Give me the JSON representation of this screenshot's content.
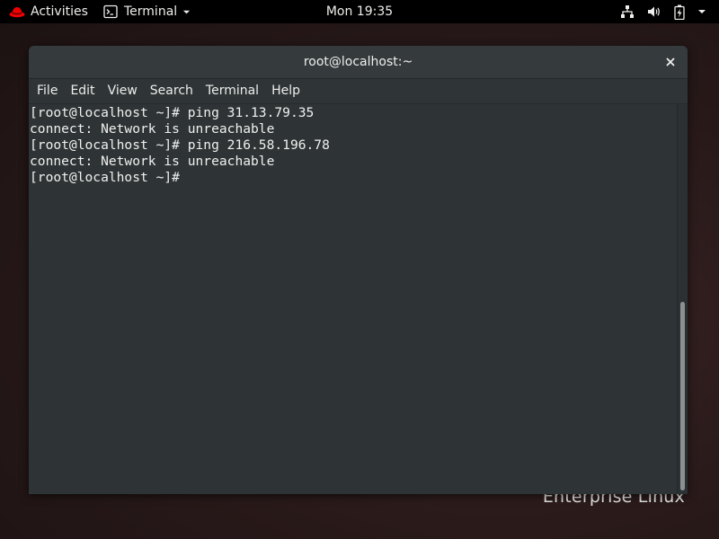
{
  "topbar": {
    "activities_label": "Activities",
    "app_menu_label": "Terminal",
    "clock": "Mon 19:35",
    "icons": [
      "network-icon",
      "volume-icon",
      "battery-icon",
      "system-menu-chevron-icon"
    ]
  },
  "window": {
    "title": "root@localhost:~",
    "menu": [
      "File",
      "Edit",
      "View",
      "Search",
      "Terminal",
      "Help"
    ],
    "terminal_lines": [
      "[root@localhost ~]# ping 31.13.79.35",
      "connect: Network is unreachable",
      "[root@localhost ~]# ping 216.58.196.78",
      "connect: Network is unreachable",
      "[root@localhost ~]#"
    ]
  },
  "desktop": {
    "watermark": "Enterprise Linux"
  },
  "colors": {
    "topbar_bg": "#000000",
    "terminal_bg": "#2e3436",
    "terminal_fg": "#f0f0ee",
    "titlebar_bg": "#353b3d",
    "brand_red": "#ee0000"
  }
}
